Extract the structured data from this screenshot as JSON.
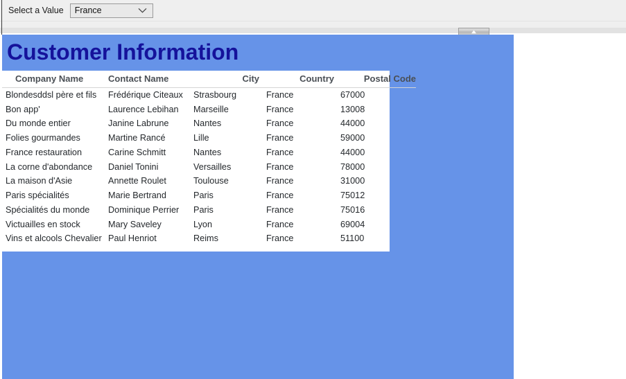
{
  "toolbar": {
    "select_label": "Select a Value",
    "selected_value": "France",
    "chevron_icon": "chevron-down-icon"
  },
  "scrollbar": {
    "thumb_icon": "up-arrow-icon"
  },
  "report": {
    "title": "Customer Information",
    "accent_blue": "#6693e8",
    "title_color": "#15129b",
    "table": {
      "headers": [
        "Company Name",
        "Contact Name",
        "City",
        "Country",
        "Postal Code"
      ],
      "rows": [
        {
          "company": "Blondesddsl père et fils",
          "contact": "Frédérique Citeaux",
          "city": "Strasbourg",
          "country": "France",
          "postal": "67000"
        },
        {
          "company": "Bon app'",
          "contact": "Laurence Lebihan",
          "city": "Marseille",
          "country": "France",
          "postal": "13008"
        },
        {
          "company": "Du monde entier",
          "contact": "Janine Labrune",
          "city": "Nantes",
          "country": "France",
          "postal": "44000"
        },
        {
          "company": "Folies gourmandes",
          "contact": "Martine Rancé",
          "city": "Lille",
          "country": "France",
          "postal": "59000"
        },
        {
          "company": "France restauration",
          "contact": "Carine Schmitt",
          "city": "Nantes",
          "country": "France",
          "postal": "44000"
        },
        {
          "company": "La corne d'abondance",
          "contact": "Daniel Tonini",
          "city": "Versailles",
          "country": "France",
          "postal": "78000"
        },
        {
          "company": "La maison d'Asie",
          "contact": "Annette Roulet",
          "city": "Toulouse",
          "country": "France",
          "postal": "31000"
        },
        {
          "company": "Paris spécialités",
          "contact": "Marie Bertrand",
          "city": "Paris",
          "country": "France",
          "postal": "75012"
        },
        {
          "company": "Spécialités du monde",
          "contact": "Dominique Perrier",
          "city": "Paris",
          "country": "France",
          "postal": "75016"
        },
        {
          "company": "Victuailles en stock",
          "contact": "Mary Saveley",
          "city": "Lyon",
          "country": "France",
          "postal": "69004"
        },
        {
          "company": "Vins et alcools Chevalier",
          "contact": "Paul Henriot",
          "city": "Reims",
          "country": "France",
          "postal": "51100"
        }
      ]
    }
  }
}
